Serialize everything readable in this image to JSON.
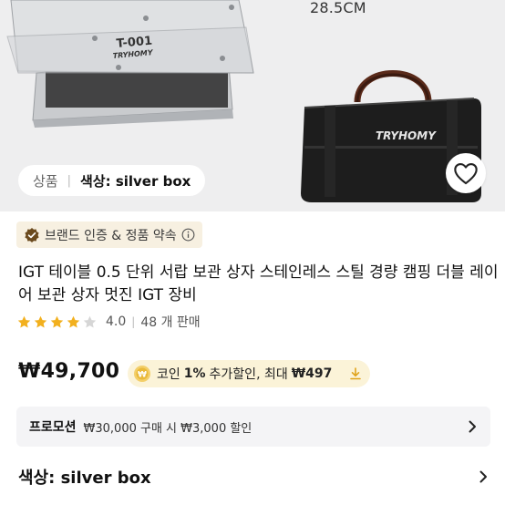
{
  "hero": {
    "size_text": "28.5CM",
    "box_stamp_line1": "T-001",
    "box_stamp_line2": "TRYHOMY",
    "bag_logo": "TRYHOMY",
    "chip": {
      "category": "상품",
      "separator": "|",
      "option": "색상: silver box"
    }
  },
  "brand_badge": {
    "text": "브랜드 인증 & 정품 약속"
  },
  "product": {
    "title": "IGT 테이블 0.5 단위 서랍 보관 상자 스테인레스 스틸 경량 캠핑 더블 레이어 보관 상자 멋진 IGT 장비",
    "rating": {
      "score": "4.0",
      "stars": 4,
      "max_stars": 5,
      "sep": "|",
      "sales": "48 개 판매"
    },
    "price": "₩49,700"
  },
  "coin": {
    "prefix": "코인",
    "percent": "1%",
    "suffix": "추가할인, 최대",
    "max": "₩497"
  },
  "promotion": {
    "label": "프로모션",
    "text": "₩30,000 구매 시 ₩3,000 할인"
  },
  "option": {
    "text": "색상: silver box"
  },
  "colors": {
    "star": "#f2b01e",
    "star_empty": "#d6d6d6",
    "badge_bg": "#f7f0e1",
    "coin_bg": "#fbf3d8",
    "promo_bg": "#f4f4f6"
  }
}
